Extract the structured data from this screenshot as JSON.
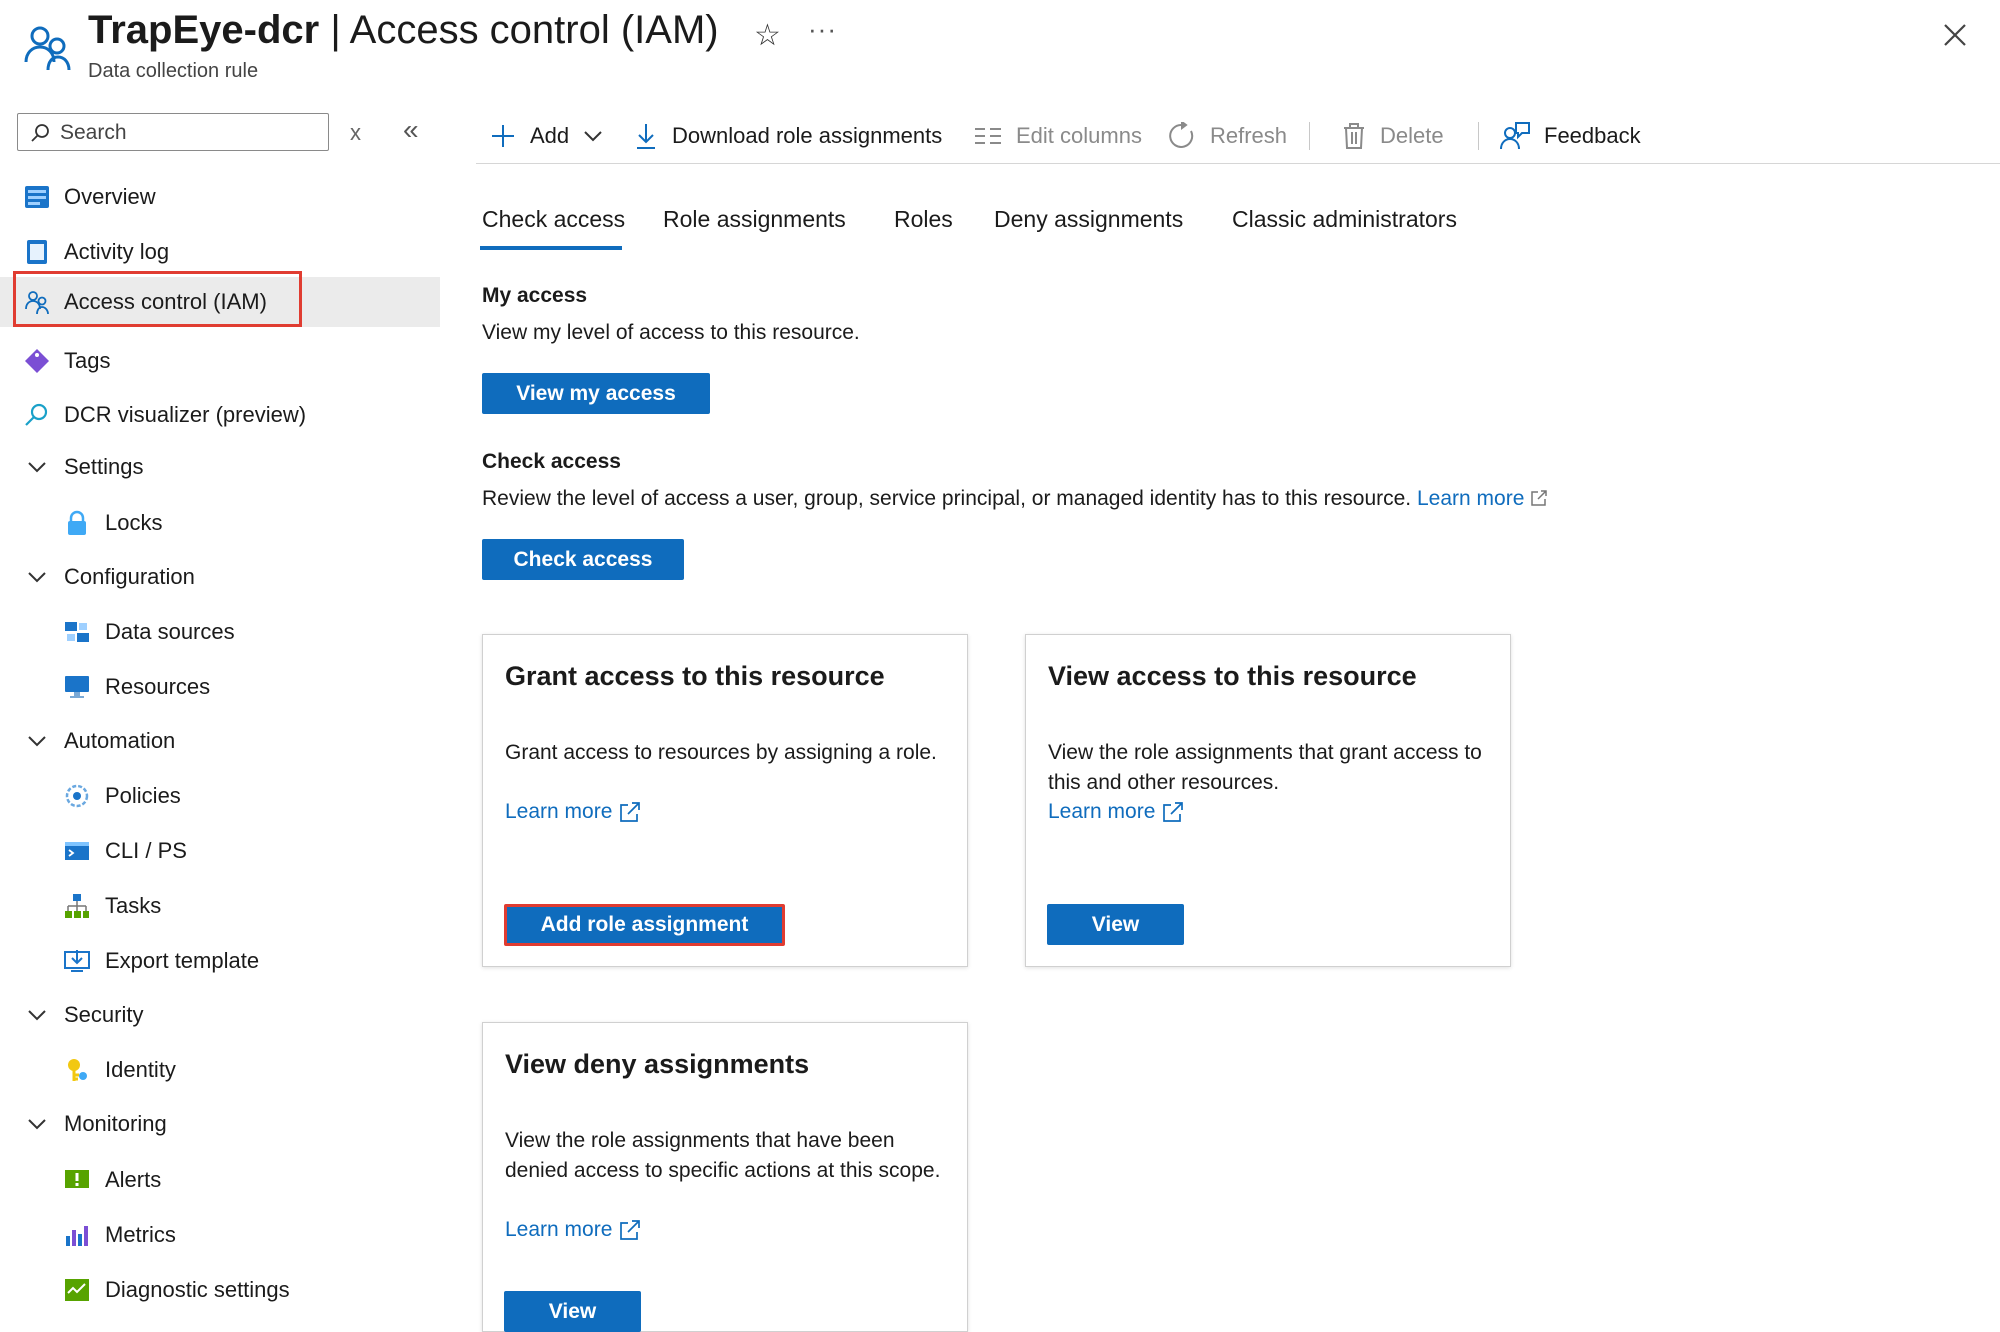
{
  "header": {
    "resource_name": "TrapEye-dcr",
    "separator": "|",
    "page_title": "Access control (IAM)",
    "subtitle": "Data collection rule",
    "star_glyph": "☆",
    "more_glyph": "···"
  },
  "sidebar": {
    "search_placeholder": "Search",
    "clear_glyph": "x",
    "collapse_glyph": "«",
    "items": [
      {
        "label": "Overview"
      },
      {
        "label": "Activity log"
      },
      {
        "label": "Access control (IAM)"
      },
      {
        "label": "Tags"
      },
      {
        "label": "DCR visualizer (preview)"
      },
      {
        "label": "Settings"
      },
      {
        "label": "Locks"
      },
      {
        "label": "Configuration"
      },
      {
        "label": "Data sources"
      },
      {
        "label": "Resources"
      },
      {
        "label": "Automation"
      },
      {
        "label": "Policies"
      },
      {
        "label": "CLI / PS"
      },
      {
        "label": "Tasks"
      },
      {
        "label": "Export template"
      },
      {
        "label": "Security"
      },
      {
        "label": "Identity"
      },
      {
        "label": "Monitoring"
      },
      {
        "label": "Alerts"
      },
      {
        "label": "Metrics"
      },
      {
        "label": "Diagnostic settings"
      }
    ]
  },
  "toolbar": {
    "add": "Add",
    "download": "Download role assignments",
    "edit_columns": "Edit columns",
    "refresh": "Refresh",
    "delete": "Delete",
    "feedback": "Feedback"
  },
  "tabs": [
    "Check access",
    "Role assignments",
    "Roles",
    "Deny assignments",
    "Classic administrators"
  ],
  "my_access": {
    "title": "My access",
    "desc": "View my level of access to this resource.",
    "button": "View my access"
  },
  "check_access": {
    "title": "Check access",
    "desc": "Review the level of access a user, group, service principal, or managed identity has to this resource.",
    "link": "Learn more",
    "button": "Check access"
  },
  "cards": [
    {
      "title": "Grant access to this resource",
      "desc": "Grant access to resources by assigning a role.",
      "link": "Learn more",
      "button": "Add role assignment"
    },
    {
      "title": "View access to this resource",
      "desc": "View the role assignments that grant access to this and other resources.",
      "link": "Learn more",
      "button": "View"
    },
    {
      "title": "View deny assignments",
      "desc": "View the role assignments that have been denied access to specific actions at this scope.",
      "link": "Learn more",
      "button": "View"
    }
  ],
  "colors": {
    "accent": "#0f6cbd",
    "highlight_outline": "#e03c31",
    "selected_bg": "#ebebeb"
  }
}
